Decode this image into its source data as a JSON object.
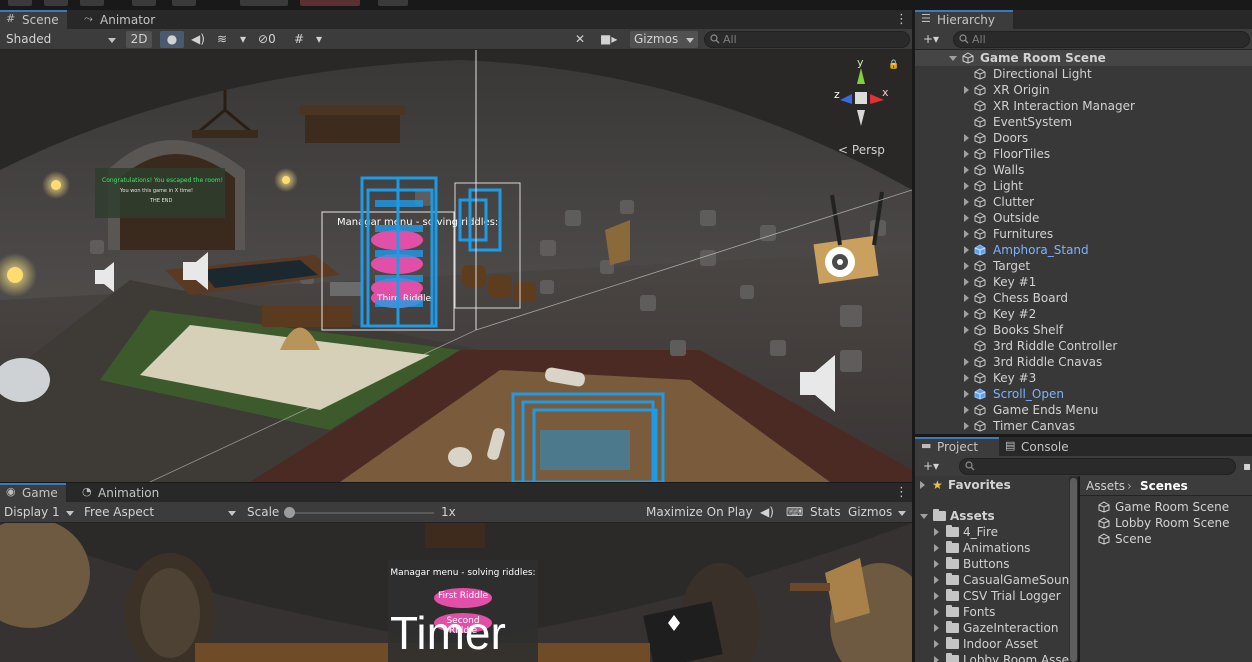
{
  "scene_panel": {
    "tabs": [
      {
        "label": "Scene",
        "icon": "grid-icon"
      },
      {
        "label": "Animator",
        "icon": "animator-icon"
      }
    ],
    "toolbar": {
      "shading_mode": "Shaded",
      "mode_2d": "2D",
      "hidden_count": "0",
      "gizmos_label": "Gizmos",
      "search_placeholder": "All"
    },
    "axis_gizmo": {
      "y": "y",
      "x": "x",
      "z": "z",
      "projection": "Persp"
    },
    "world_text": {
      "menu_title": "Managar menu - solving riddles:",
      "button_third": "Third Riddle",
      "green_line": "Congratulations! You escaped the room!",
      "white_line_1": "You won this game in X time!",
      "white_line_2": "THE END"
    }
  },
  "game_panel": {
    "tabs": [
      {
        "label": "Game",
        "icon": "gamepad-icon"
      },
      {
        "label": "Animation",
        "icon": "clock-icon"
      }
    ],
    "toolbar": {
      "display": "Display 1",
      "aspect": "Free Aspect",
      "scale_label": "Scale",
      "scale_value": "1x",
      "maximize": "Maximize On Play",
      "stats": "Stats",
      "gizmos": "Gizmos"
    },
    "overlay": {
      "menu_title": "Managar menu - solving riddles:",
      "button_first": "First Riddle",
      "button_second": "Second Riddle",
      "timer": "Timer"
    }
  },
  "hierarchy": {
    "tab": "Hierarchy",
    "search_placeholder": "All",
    "scene_name": "Game Room Scene",
    "items": [
      {
        "label": "Directional Light",
        "expandable": false,
        "prefab": false
      },
      {
        "label": "XR Origin",
        "expandable": true,
        "prefab": false
      },
      {
        "label": "XR Interaction Manager",
        "expandable": false,
        "prefab": false
      },
      {
        "label": "EventSystem",
        "expandable": false,
        "prefab": false
      },
      {
        "label": "Doors",
        "expandable": true,
        "prefab": false
      },
      {
        "label": "FloorTiles",
        "expandable": true,
        "prefab": false
      },
      {
        "label": "Walls",
        "expandable": true,
        "prefab": false
      },
      {
        "label": "Light",
        "expandable": true,
        "prefab": false
      },
      {
        "label": "Clutter",
        "expandable": true,
        "prefab": false
      },
      {
        "label": "Outside",
        "expandable": true,
        "prefab": false
      },
      {
        "label": "Furnitures",
        "expandable": true,
        "prefab": false
      },
      {
        "label": "Amphora_Stand",
        "expandable": true,
        "prefab": true
      },
      {
        "label": "Target",
        "expandable": true,
        "prefab": false
      },
      {
        "label": "Key #1",
        "expandable": true,
        "prefab": false
      },
      {
        "label": "Chess Board",
        "expandable": true,
        "prefab": false
      },
      {
        "label": "Key #2",
        "expandable": true,
        "prefab": false
      },
      {
        "label": "Books Shelf",
        "expandable": true,
        "prefab": false
      },
      {
        "label": "3rd Riddle Controller",
        "expandable": false,
        "prefab": false
      },
      {
        "label": "3rd Riddle Cnavas",
        "expandable": true,
        "prefab": false
      },
      {
        "label": "Key #3",
        "expandable": true,
        "prefab": false
      },
      {
        "label": "Scroll_Open",
        "expandable": true,
        "prefab": true
      },
      {
        "label": "Game Ends Menu",
        "expandable": true,
        "prefab": false
      },
      {
        "label": "Timer Canvas",
        "expandable": true,
        "prefab": false
      }
    ]
  },
  "project": {
    "tabs": [
      {
        "label": "Project",
        "icon": "folder-icon"
      },
      {
        "label": "Console",
        "icon": "console-icon"
      }
    ],
    "favorites": "Favorites",
    "assets_root": "Assets",
    "folders": [
      "4_Fire",
      "Animations",
      "Buttons",
      "CasualGameSounds",
      "CSV Trial Logger",
      "Fonts",
      "GazeInteraction",
      "Indoor Asset",
      "Lobby Room Asset"
    ],
    "breadcrumb": [
      "Assets",
      "Scenes"
    ],
    "scene_files": [
      "Game Room Scene",
      "Lobby Room Scene",
      "Scene"
    ]
  },
  "colors": {
    "accent": "#3a79bb",
    "selection_blue": "#1e9be6",
    "prefab_blue": "#7cb3ff",
    "button_pink": "#e24fa7"
  }
}
